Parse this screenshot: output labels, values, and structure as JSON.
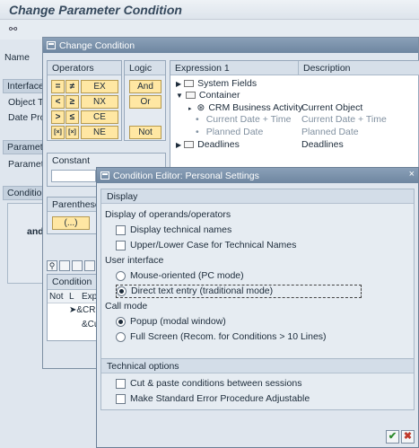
{
  "main": {
    "title": "Change Parameter Condition",
    "labels": {
      "name": "Name",
      "interface": "Interface",
      "object_type": "Object T",
      "date_pro": "Date Pro",
      "parameter1": "Paramete",
      "parameter2": "Paramete",
      "condition": "Condition",
      "and": "and"
    }
  },
  "change_condition": {
    "title": "Change Condition",
    "operators_head": "Operators",
    "logic_head": "Logic",
    "operators": {
      "ex": "EX",
      "nx": "NX",
      "ce": "CE",
      "ne": "NE",
      "sym_eq": "=",
      "sym_neq": "≠",
      "sym_lt": "<",
      "sym_ge": "≥",
      "sym_gt": ">",
      "sym_le": "≤",
      "sym_bracket": "[×]",
      "sym_bracket2": "[×]"
    },
    "logic": {
      "and": "And",
      "or": "Or",
      "not": "Not"
    },
    "constant_head": "Constant",
    "parentheses_head": "Parentheses",
    "paren_btn": "(...)",
    "expression_head": "Expression 1",
    "description_head": "Description",
    "tree": [
      {
        "label": "System Fields",
        "desc": ""
      },
      {
        "label": "Container",
        "desc": ""
      },
      {
        "label": "CRM Business Activity",
        "desc": "Current Object"
      },
      {
        "label": "Current Date + Time",
        "desc": "Current Date + Time"
      },
      {
        "label": "Planned Date",
        "desc": "Planned Date"
      },
      {
        "label": "Deadlines",
        "desc": "Deadlines"
      }
    ],
    "grid": {
      "tab": "Condition",
      "col_not": "Not",
      "col_l": "L",
      "col_exp": "Exp",
      "row1": "&CR",
      "row2": "&Cu"
    }
  },
  "editor": {
    "title": "Condition Editor: Personal Settings",
    "display_head": "Display",
    "display_ops_label": "Display of operands/operators",
    "opt_tech_names": "Display technical names",
    "opt_case": "Upper/Lower Case for Technical Names",
    "ui_label": "User interface",
    "opt_mouse": "Mouse-oriented (PC mode)",
    "opt_text": "Direct text entry (traditional mode)",
    "call_mode_label": "Call mode",
    "opt_popup": "Popup (modal window)",
    "opt_fullscreen": "Full Screen (Recom. for Conditions > 10 Lines)",
    "tech_head": "Technical options",
    "opt_cut_paste": "Cut & paste conditions between sessions",
    "opt_std_error": "Make Standard Error Procedure Adjustable",
    "close": "×",
    "ok_icon": "✔",
    "cancel_icon": "✖"
  },
  "colors": {
    "button_fill": "#ffe7a3",
    "title_bar": "#7a92ac",
    "background": "#dfe6ee"
  }
}
